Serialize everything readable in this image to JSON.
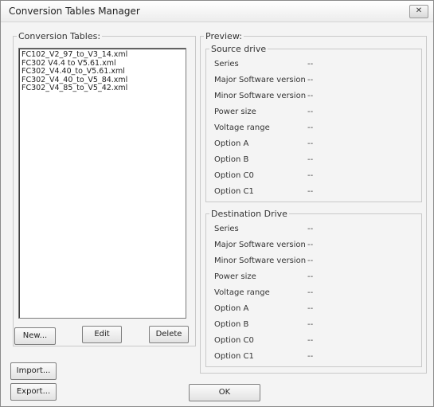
{
  "window": {
    "title": "Conversion Tables Manager",
    "close_label": "✕"
  },
  "conversion_tables": {
    "legend": "Conversion Tables:",
    "items": [
      "FC102_V2_97_to_V3_14.xml",
      "FC302 V4.4 to V5.61.xml",
      "FC302_V4.40_to_V5.61.xml",
      "FC302_V4_40_to_V5_84.xml",
      "FC302_V4_85_to_V5_42.xml"
    ],
    "buttons": {
      "new": "New...",
      "edit": "Edit",
      "delete": "Delete",
      "import": "Import...",
      "export": "Export..."
    }
  },
  "preview": {
    "legend": "Preview:",
    "source": {
      "legend": "Source drive",
      "rows": [
        {
          "label": "Series",
          "value": "--"
        },
        {
          "label": "Major Software version",
          "value": "--"
        },
        {
          "label": "Minor Software version",
          "value": "--"
        },
        {
          "label": "Power size",
          "value": "--"
        },
        {
          "label": "Voltage range",
          "value": "--"
        },
        {
          "label": "Option A",
          "value": "--"
        },
        {
          "label": "Option B",
          "value": "--"
        },
        {
          "label": "Option C0",
          "value": "--"
        },
        {
          "label": "Option C1",
          "value": "--"
        }
      ]
    },
    "destination": {
      "legend": "Destination Drive",
      "rows": [
        {
          "label": "Series",
          "value": "--"
        },
        {
          "label": "Major Software version",
          "value": "--"
        },
        {
          "label": "Minor Software version",
          "value": "--"
        },
        {
          "label": "Power size",
          "value": "--"
        },
        {
          "label": "Voltage range",
          "value": "--"
        },
        {
          "label": "Option A",
          "value": "--"
        },
        {
          "label": "Option B",
          "value": "--"
        },
        {
          "label": "Option C0",
          "value": "--"
        },
        {
          "label": "Option C1",
          "value": "--"
        }
      ]
    }
  },
  "footer": {
    "ok": "OK"
  }
}
